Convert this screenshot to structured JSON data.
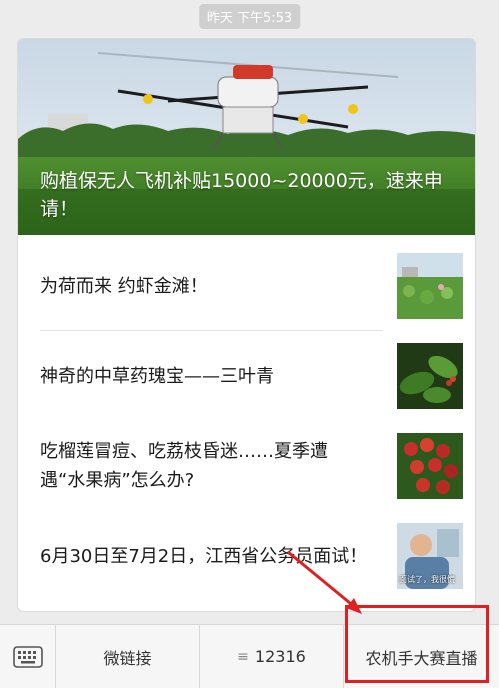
{
  "timestamp": "昨天 下午5:53",
  "hero": {
    "title": "购植保无人飞机补贴15000~20000元，速来申请！"
  },
  "articles": [
    {
      "title": "为荷而来 约虾金滩！"
    },
    {
      "title": "神奇的中草药瑰宝——三叶青"
    },
    {
      "title": "吃榴莲冒痘、吃荔枝昏迷……夏季遭遇“水果病”怎么办?"
    },
    {
      "title": "6月30日至7月2日，江西省公务员面试！",
      "thumb_caption": "面试了，我很慌"
    }
  ],
  "bottom_menu": {
    "item1": "微链接",
    "item2": "12316",
    "item3": "农机手大赛直播"
  },
  "colors": {
    "highlight": "#e02020",
    "card_bg": "#ffffff",
    "page_bg": "#ececec"
  },
  "icons": [
    "keyboard-icon",
    "menu-list-icon"
  ]
}
